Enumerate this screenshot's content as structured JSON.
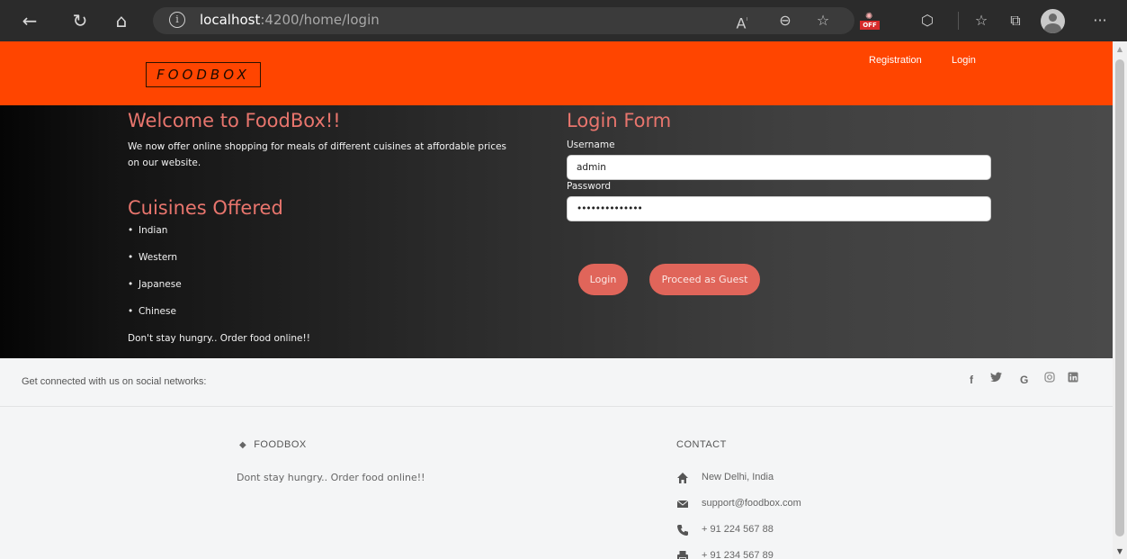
{
  "browser": {
    "url_host": "localhost",
    "url_path": ":4200/home/login",
    "extension_badge": "OFF"
  },
  "navbar": {
    "logo": "FOODBOX",
    "links": [
      "Registration",
      "Login"
    ]
  },
  "hero": {
    "welcome_title": "Welcome to FoodBox!!",
    "welcome_text_line1": "We now offer online shopping for meals of different cuisines at affordable prices",
    "welcome_text_line2": "on our website.",
    "cuisines_title": "Cuisines Offered",
    "cuisines": [
      "Indian",
      "Western",
      "Japanese",
      "Chinese"
    ],
    "tagline": "Don't stay hungry.. Order food online!!"
  },
  "login_form": {
    "title": "Login Form",
    "username_label": "Username",
    "username_value": "admin",
    "password_label": "Password",
    "password_value": "••••••••••••••",
    "login_button": "Login",
    "guest_button": "Proceed as Guest"
  },
  "social": {
    "text": "Get connected with us on social networks:",
    "icons": [
      "f",
      "G"
    ]
  },
  "footer": {
    "brand": "FOODBOX",
    "brand_text": "Dont stay hungry.. Order food online!!",
    "contact_heading": "CONTACT",
    "contact": [
      "New Delhi, India",
      "support@foodbox.com",
      "+ 91 224 567 88",
      "+ 91 234 567 89"
    ]
  },
  "colors": {
    "navbar": "#ff4500",
    "accent": "#e0655a"
  }
}
